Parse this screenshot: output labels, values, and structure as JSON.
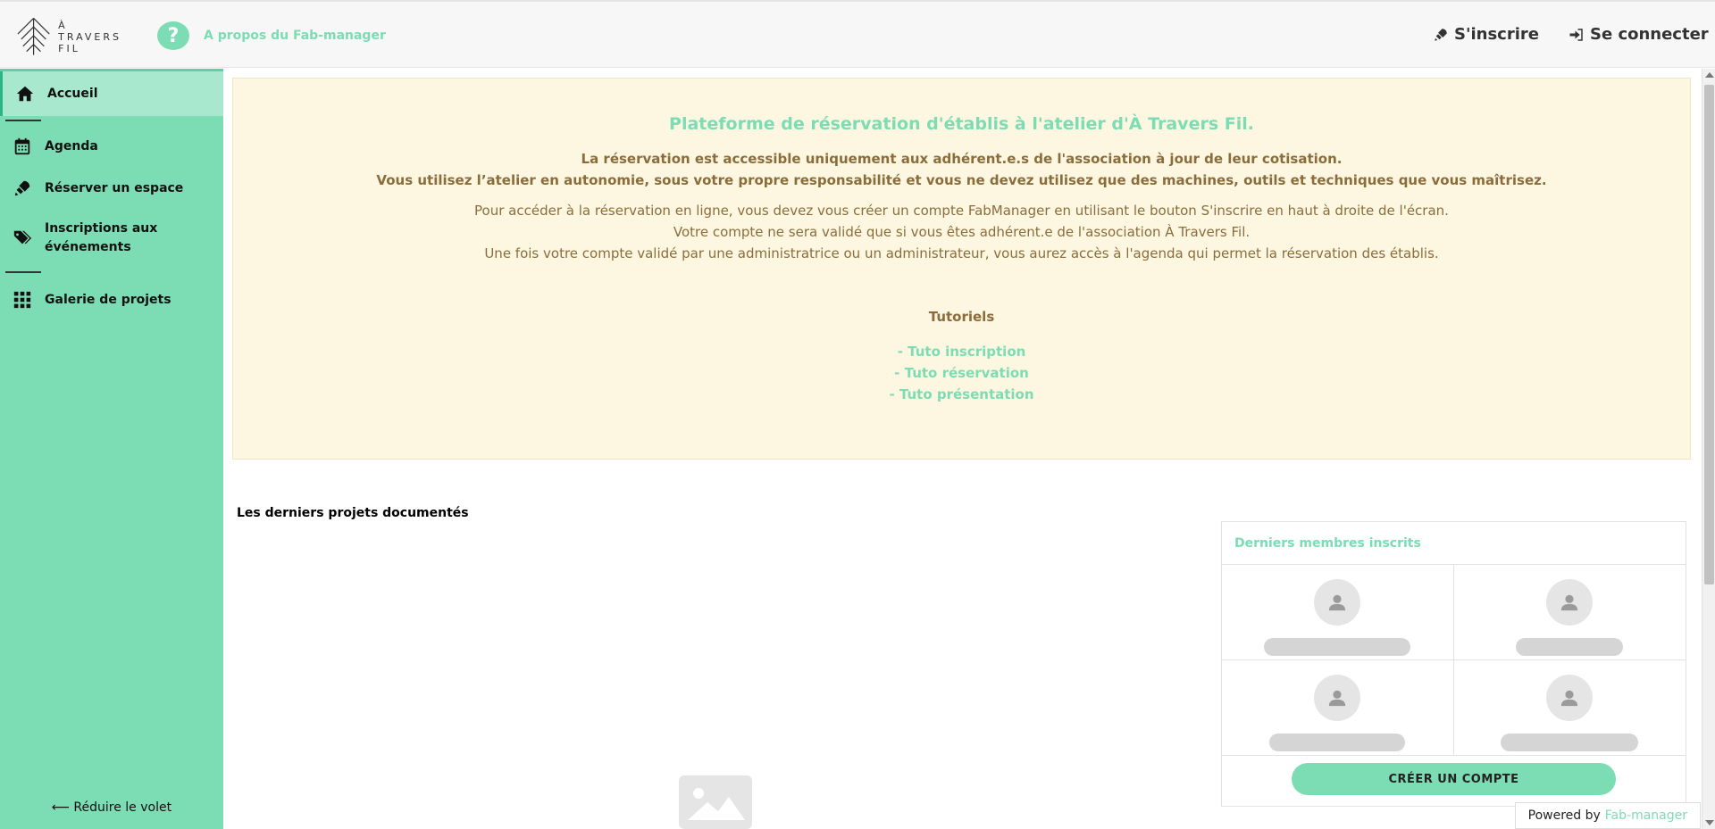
{
  "header": {
    "logo_text": [
      "À",
      "TRAVERS",
      "FIL"
    ],
    "about_label": "A propos du Fab-manager",
    "signup_label": "S'inscrire",
    "login_label": "Se connecter"
  },
  "sidebar": {
    "items": [
      {
        "label": "Accueil",
        "icon": "home-icon"
      },
      {
        "label": "Agenda",
        "icon": "calendar-icon"
      },
      {
        "label": "Réserver un espace",
        "icon": "rocket-icon"
      },
      {
        "label": "Inscriptions aux événements",
        "icon": "tags-icon"
      },
      {
        "label": "Galerie de projets",
        "icon": "grid-icon"
      }
    ],
    "collapse_label": "⟵ Réduire le volet"
  },
  "hero": {
    "title": "Plateforme de réservation d'établis à l'atelier d'À Travers Fil.",
    "bold_lines": [
      "La réservation est accessible uniquement aux adhérent.e.s de l'association à jour de leur cotisation.",
      "Vous utilisez l’atelier en autonomie, sous votre propre responsabilité et vous ne devez utilisez que des machines, outils et techniques que vous maîtrisez."
    ],
    "lines": [
      "Pour accéder à la réservation en ligne, vous devez vous créer un compte FabManager en utilisant le bouton S'inscrire en haut à droite de l'écran.",
      "Votre compte ne sera validé que si vous êtes adhérent.e de l'association À Travers Fil.",
      "Une fois votre compte validé par une administratrice ou un administrateur, vous aurez accès à l'agenda qui permet la réservation des établis."
    ],
    "tutorials_title": "Tutoriels",
    "tutorials": [
      "- Tuto inscription",
      "- Tuto réservation",
      "- Tuto présentation"
    ]
  },
  "projects": {
    "title": "Les derniers projets documentés"
  },
  "members": {
    "title": "Derniers membres inscrits",
    "create_account_label": "CRÉER UN COMPTE"
  },
  "footer": {
    "powered_by": "Powered by",
    "powered_link": "Fab-manager"
  },
  "colors": {
    "accent": "#7cdcb4",
    "hero_bg": "#fdf7e2",
    "hero_text": "#8a6d3b"
  }
}
